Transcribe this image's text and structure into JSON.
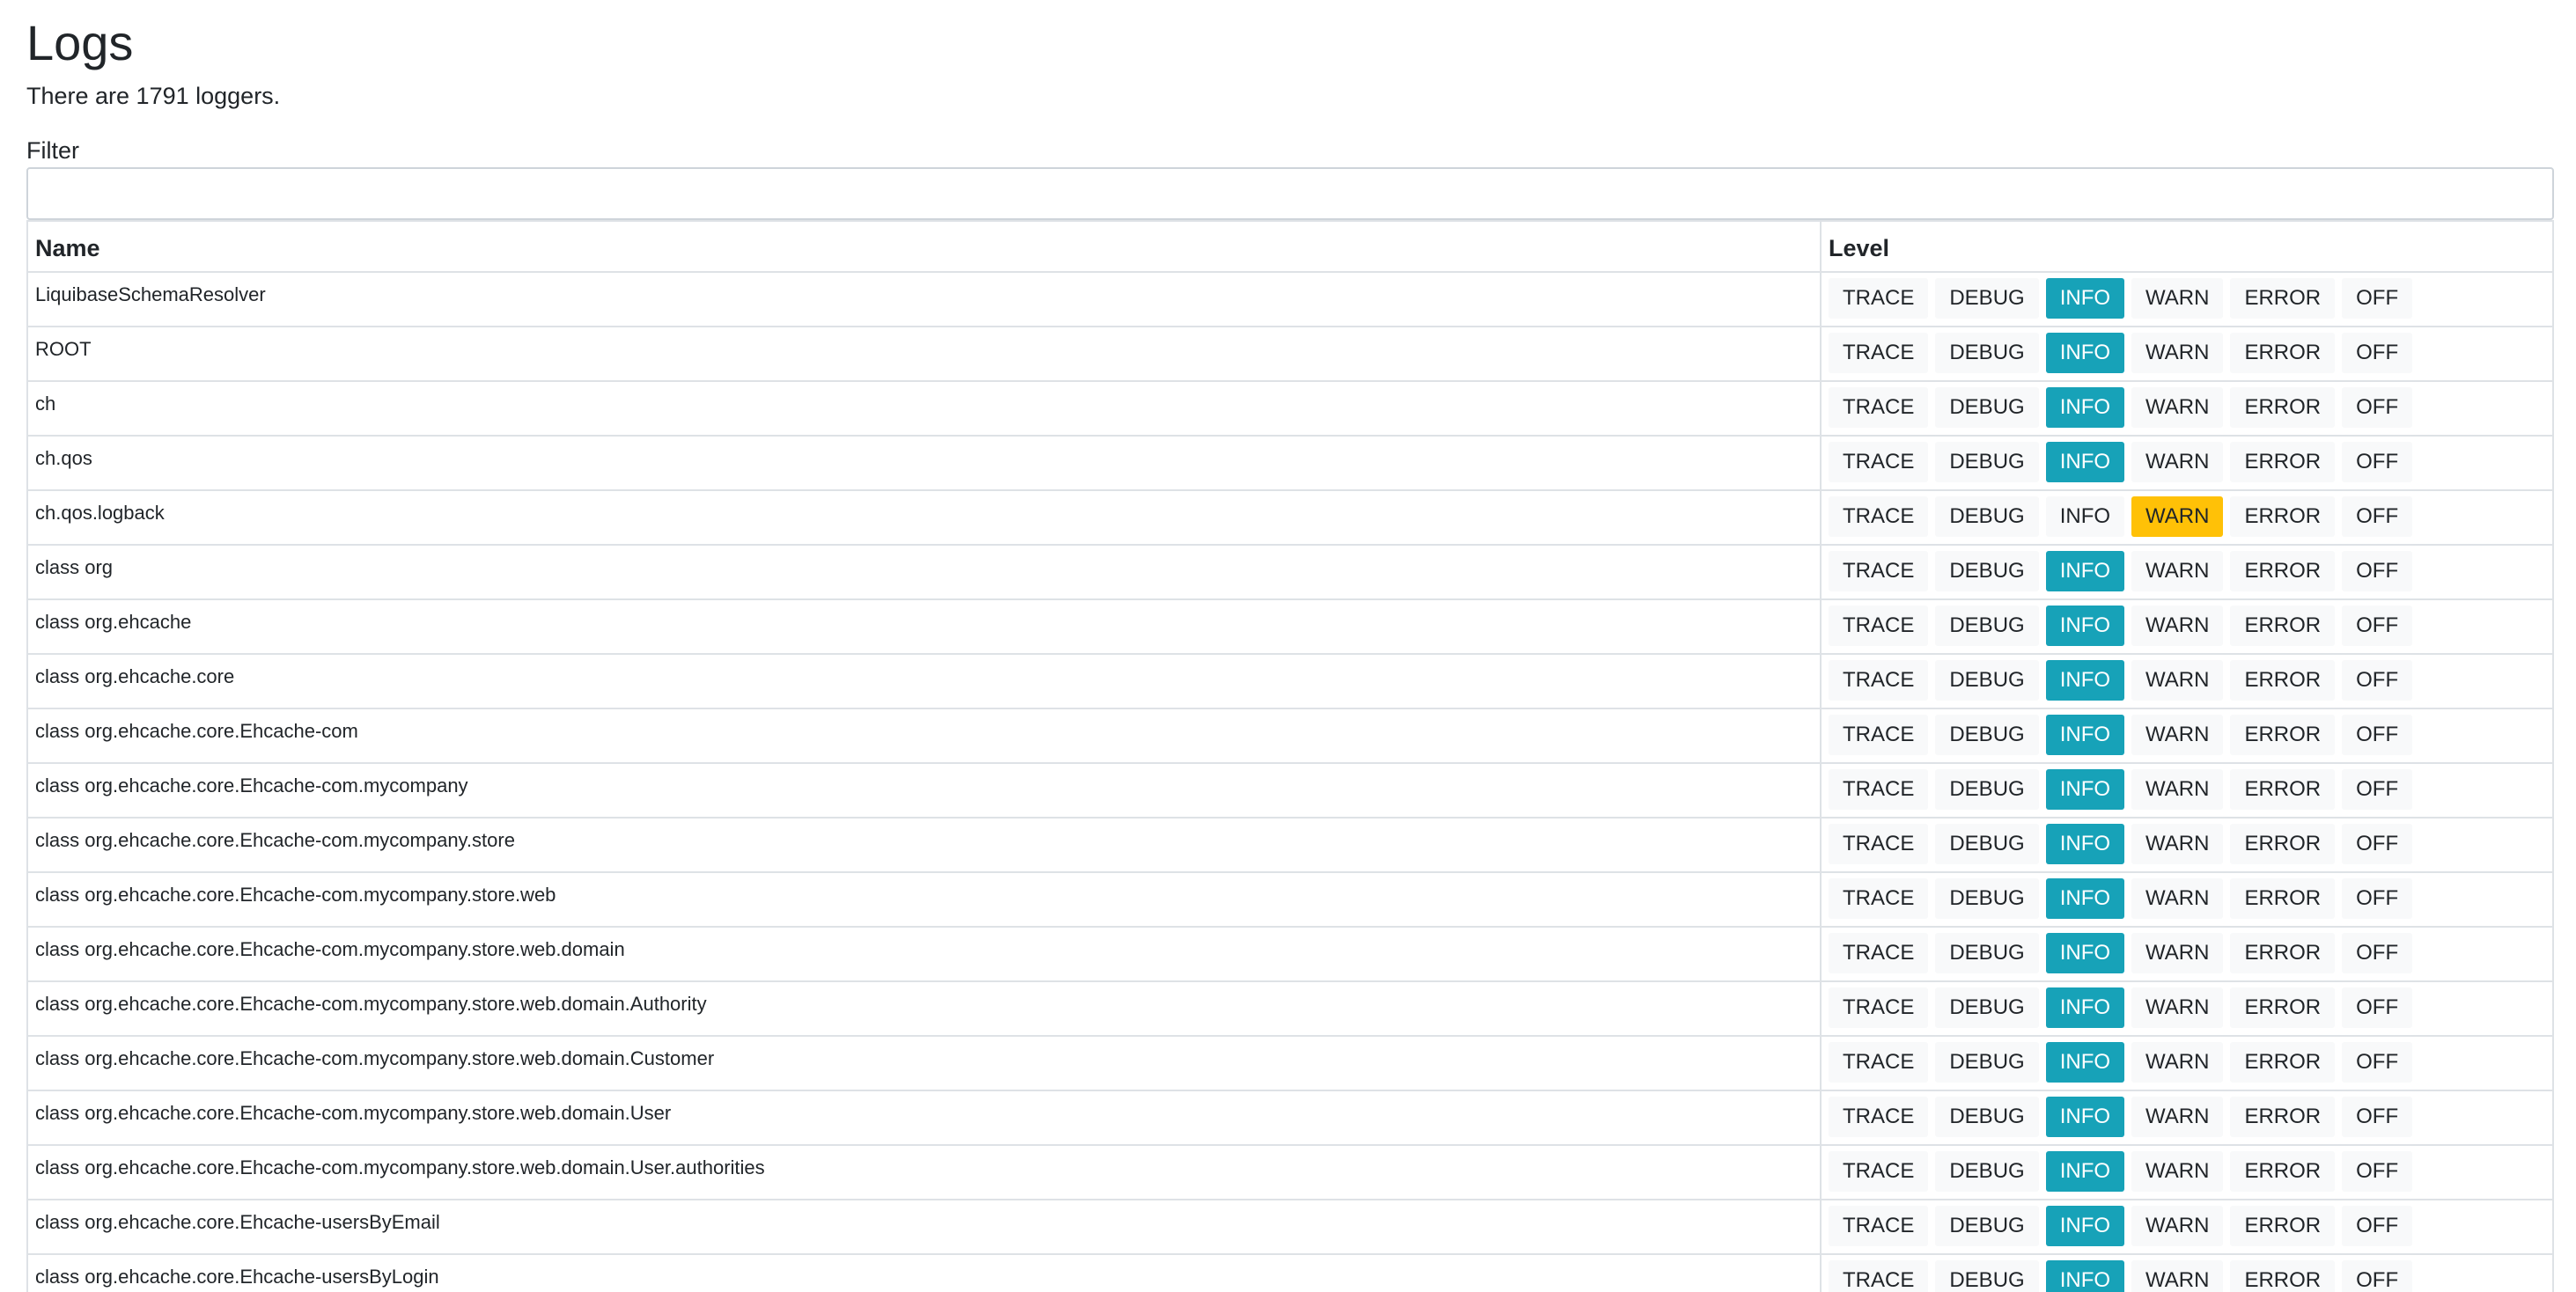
{
  "page": {
    "title": "Logs",
    "count_text": "There are 1791 loggers.",
    "filter_label": "Filter",
    "filter_value": "",
    "filter_placeholder": ""
  },
  "table": {
    "columns": [
      "Name",
      "Level"
    ],
    "levels": [
      "TRACE",
      "DEBUG",
      "INFO",
      "WARN",
      "ERROR",
      "OFF"
    ],
    "colors": {
      "info_active": "#17a2b8",
      "warn_active": "#ffc107",
      "inactive": "#f8f9fa"
    },
    "rows": [
      {
        "name": "LiquibaseSchemaResolver",
        "level": "INFO"
      },
      {
        "name": "ROOT",
        "level": "INFO"
      },
      {
        "name": "ch",
        "level": "INFO"
      },
      {
        "name": "ch.qos",
        "level": "INFO"
      },
      {
        "name": "ch.qos.logback",
        "level": "WARN"
      },
      {
        "name": "class org",
        "level": "INFO"
      },
      {
        "name": "class org.ehcache",
        "level": "INFO"
      },
      {
        "name": "class org.ehcache.core",
        "level": "INFO"
      },
      {
        "name": "class org.ehcache.core.Ehcache-com",
        "level": "INFO"
      },
      {
        "name": "class org.ehcache.core.Ehcache-com.mycompany",
        "level": "INFO"
      },
      {
        "name": "class org.ehcache.core.Ehcache-com.mycompany.store",
        "level": "INFO"
      },
      {
        "name": "class org.ehcache.core.Ehcache-com.mycompany.store.web",
        "level": "INFO"
      },
      {
        "name": "class org.ehcache.core.Ehcache-com.mycompany.store.web.domain",
        "level": "INFO"
      },
      {
        "name": "class org.ehcache.core.Ehcache-com.mycompany.store.web.domain.Authority",
        "level": "INFO"
      },
      {
        "name": "class org.ehcache.core.Ehcache-com.mycompany.store.web.domain.Customer",
        "level": "INFO"
      },
      {
        "name": "class org.ehcache.core.Ehcache-com.mycompany.store.web.domain.User",
        "level": "INFO"
      },
      {
        "name": "class org.ehcache.core.Ehcache-com.mycompany.store.web.domain.User.authorities",
        "level": "INFO"
      },
      {
        "name": "class org.ehcache.core.Ehcache-usersByEmail",
        "level": "INFO"
      },
      {
        "name": "class org.ehcache.core.Ehcache-usersByLogin",
        "level": "INFO"
      }
    ]
  }
}
